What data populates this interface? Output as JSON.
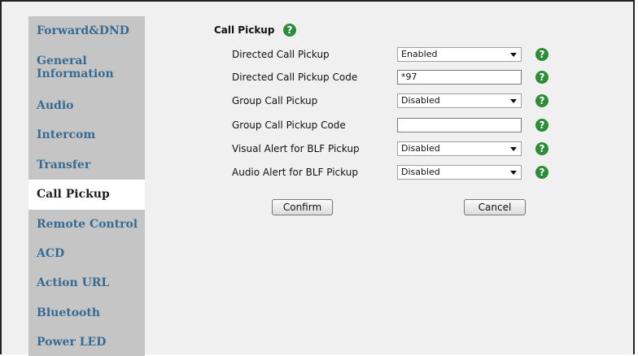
{
  "sidebar": {
    "items": [
      {
        "label": "Forward&DND"
      },
      {
        "label_line1": "General",
        "label_line2": "Information"
      },
      {
        "label": "Audio"
      },
      {
        "label": "Intercom"
      },
      {
        "label": "Transfer"
      },
      {
        "label": "Call Pickup"
      },
      {
        "label": "Remote Control"
      },
      {
        "label": "ACD"
      },
      {
        "label": "Action URL"
      },
      {
        "label": "Bluetooth"
      },
      {
        "label": "Power LED"
      }
    ],
    "active": "Call Pickup"
  },
  "section": {
    "title": "Call Pickup",
    "help_glyph": "?"
  },
  "fields": [
    {
      "label": "Directed Call Pickup",
      "type": "select",
      "value": "Enabled"
    },
    {
      "label": "Directed Call Pickup Code",
      "type": "text",
      "value": "*97"
    },
    {
      "label": "Group Call Pickup",
      "type": "select",
      "value": "Disabled"
    },
    {
      "label": "Group Call Pickup Code",
      "type": "text",
      "value": ""
    },
    {
      "label": "Visual Alert for BLF Pickup",
      "type": "select",
      "value": "Disabled"
    },
    {
      "label": "Audio Alert for BLF Pickup",
      "type": "select",
      "value": "Disabled"
    }
  ],
  "buttons": {
    "confirm": "Confirm",
    "cancel": "Cancel"
  },
  "colors": {
    "sidebar_bg": "#c5c5c5",
    "sidebar_link": "#386b94",
    "help_icon": "#2e8b3a",
    "content_bg": "#f0f0f0"
  }
}
